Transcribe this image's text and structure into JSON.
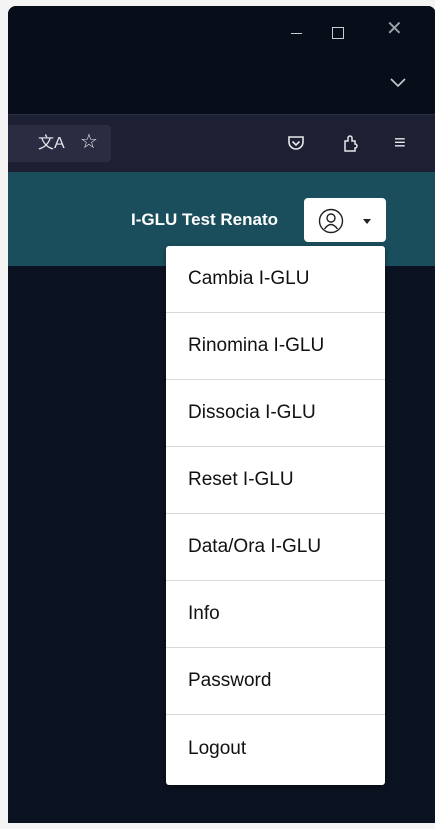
{
  "window": {
    "controls": [
      "minimize",
      "maximize",
      "close"
    ]
  },
  "toolbar": {
    "icons": [
      "translate-icon",
      "bookmark-star-icon",
      "pocket-icon",
      "extensions-icon",
      "menu-icon"
    ]
  },
  "header": {
    "title": "I-GLU Test Renato",
    "user_button_icon": "user-circle-icon",
    "bg_color": "#1b4e5c"
  },
  "dropdown": {
    "items": [
      {
        "label": "Cambia I-GLU"
      },
      {
        "label": "Rinomina I-GLU"
      },
      {
        "label": "Dissocia I-GLU"
      },
      {
        "label": "Reset I-GLU"
      },
      {
        "label": "Data/Ora I-GLU"
      },
      {
        "label": "Info"
      },
      {
        "label": "Password"
      },
      {
        "label": "Logout"
      }
    ]
  },
  "colors": {
    "page_bg": "#0b1221",
    "toolbar_bg": "#1d2033"
  }
}
